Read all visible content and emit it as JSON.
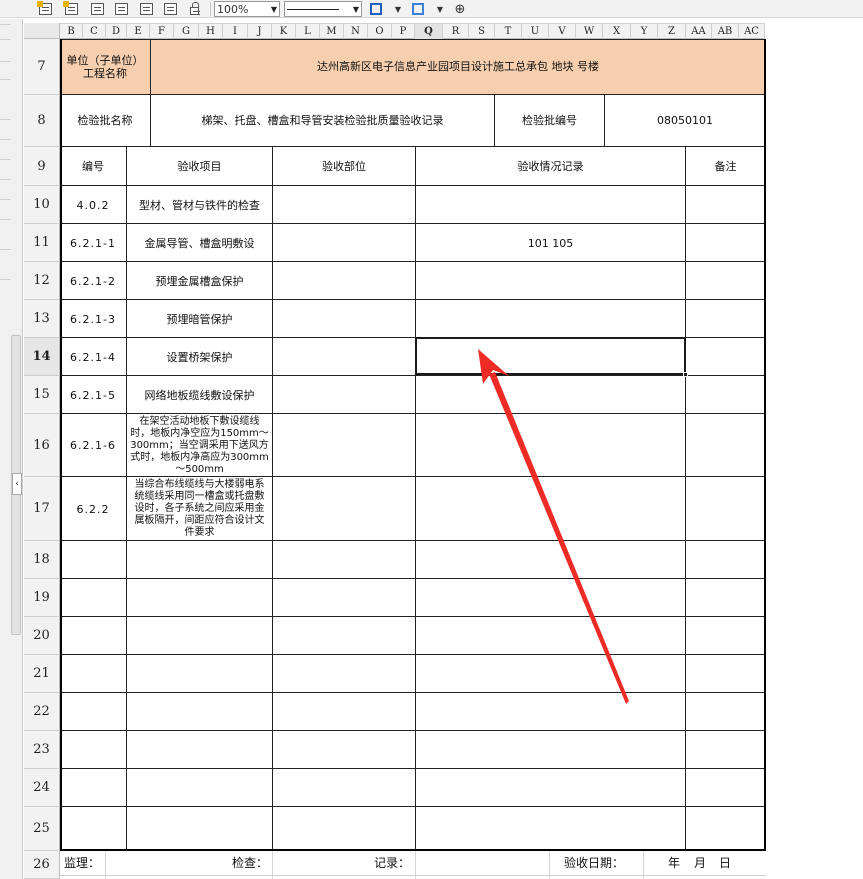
{
  "toolbar": {
    "zoom": "100%",
    "icons": [
      "insert-row-icon",
      "insert-col-icon",
      "table-icon",
      "grid-icon",
      "format-icon",
      "print-icon",
      "lock-icon"
    ],
    "border_icon": "border-style-icon",
    "fill_icon": "fill-color-icon",
    "anchor_icon": "anchor-icon"
  },
  "columns": [
    "B",
    "C",
    "D",
    "E",
    "F",
    "G",
    "H",
    "I",
    "J",
    "K",
    "L",
    "M",
    "N",
    "O",
    "P",
    "Q",
    "R",
    "S",
    "T",
    "U",
    "V",
    "W",
    "X",
    "Y",
    "Z",
    "AA",
    "AB",
    "AC"
  ],
  "selected_column": "Q",
  "rows": [
    "7",
    "8",
    "9",
    "10",
    "11",
    "12",
    "13",
    "14",
    "15",
    "16",
    "17",
    "18",
    "19",
    "20",
    "21",
    "22",
    "23",
    "24",
    "25",
    "26"
  ],
  "selected_row": "14",
  "sheet": {
    "unit_label": "单位（子单位）\n工程名称",
    "project_name": "达州高新区电子信息产业园项目设计施工总承包    地块    号楼",
    "batch_name_label": "检验批名称",
    "batch_name": "梯架、托盘、槽盒和导管安装检验批质量验收记录",
    "batch_no_label": "检验批编号",
    "batch_no": "08050101",
    "headers": {
      "num": "编号",
      "item": "验收项目",
      "location": "验收部位",
      "record": "验收情况记录",
      "note": "备注"
    },
    "items": [
      {
        "num": "4.0.2",
        "item": "型材、管材与铁件的检查",
        "record": ""
      },
      {
        "num": "6.2.1-1",
        "item": "金属导管、槽盒明敷设",
        "record": "101  105"
      },
      {
        "num": "6.2.1-2",
        "item": "预埋金属槽盒保护",
        "record": ""
      },
      {
        "num": "6.2.1-3",
        "item": "预埋暗管保护",
        "record": ""
      },
      {
        "num": "6.2.1-4",
        "item": "设置桥架保护",
        "record": ""
      },
      {
        "num": "6.2.1-5",
        "item": "网络地板缆线敷设保护",
        "record": ""
      },
      {
        "num": "6.2.1-6",
        "item": "在架空活动地板下敷设缆线时，地板内净空应为150mm～300mm；当空调采用下送风方式时，地板内净高应为300mm～500mm",
        "record": ""
      },
      {
        "num": "6.2.2",
        "item": "当综合布线缆线与大楼弱电系统缆线采用同一槽盒或托盘敷设时，各子系统之间应采用金属板隔开，间距应符合设计文件要求",
        "record": ""
      }
    ],
    "footer": {
      "supervisor": "监理：",
      "inspector": "检查：",
      "recorder": "记录：",
      "date_label": "验收日期：",
      "year": "年",
      "month": "月",
      "day": "日"
    }
  },
  "annotation": {
    "color": "#ee2b24"
  }
}
